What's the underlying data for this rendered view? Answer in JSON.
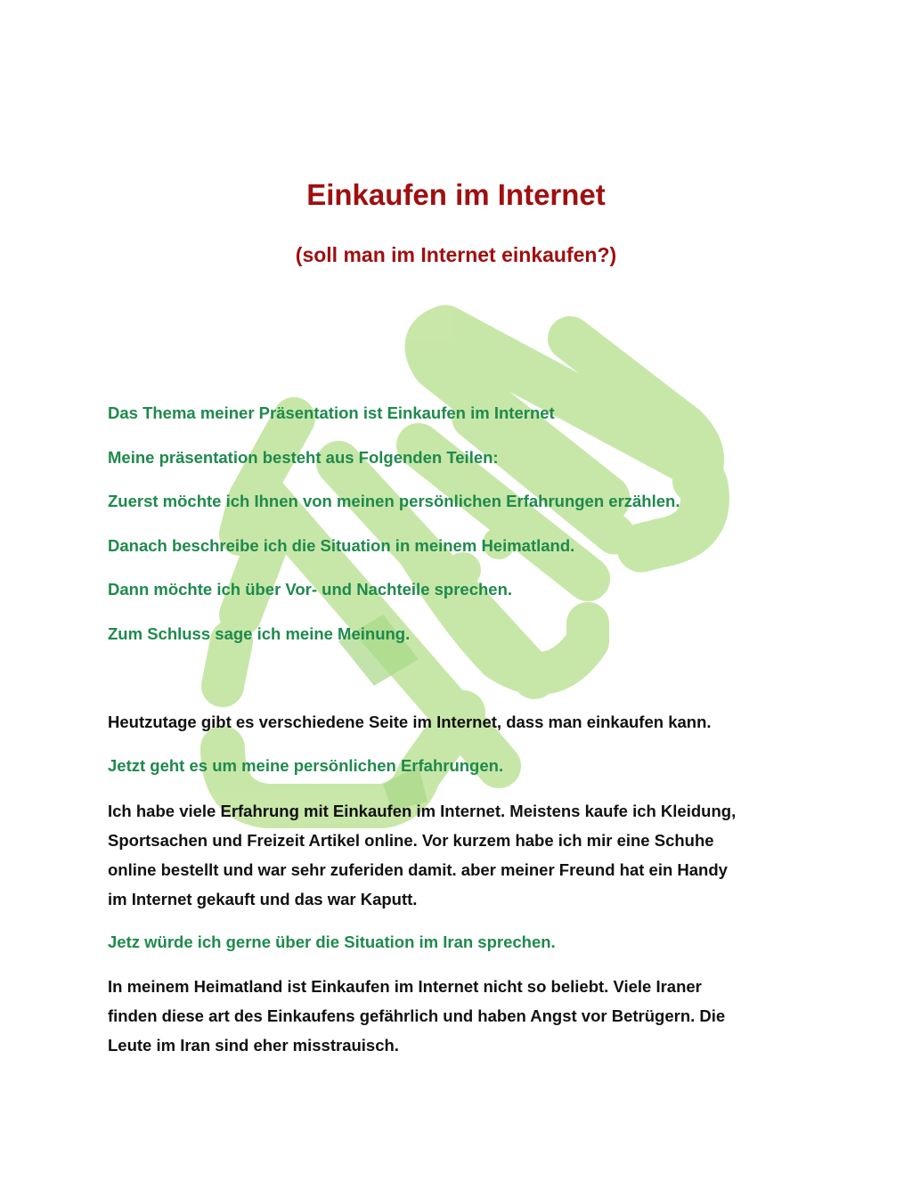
{
  "document": {
    "title": "Einkaufen im Internet",
    "subtitle": "(soll man im Internet einkaufen?)",
    "intro_lines": [
      "Das Thema meiner Präsentation ist Einkaufen im Internet",
      "Meine präsentation besteht aus Folgenden Teilen:",
      "Zuerst möchte ich Ihnen von meinen persönlichen Erfahrungen erzählen.",
      "Danach beschreibe ich die Situation in meinem Heimatland.",
      "Dann möchte ich über Vor-  und Nachteile sprechen.",
      "Zum Schluss sage ich meine Meinung."
    ],
    "statement": "Heutzutage gibt es verschiedene Seite im Internet, dass man einkaufen kann.",
    "transition_1": "Jetzt geht es um meine persönlichen Erfahrungen.",
    "paragraph_1": [
      "Ich habe viele Erfahrung mit Einkaufen im Internet. Meistens kaufe ich Kleidung,",
      "Sportsachen und Freizeit Artikel online. Vor kurzem habe ich mir eine Schuhe",
      "online bestellt und war sehr zuferiden damit. aber meiner Freund hat ein Handy",
      "im Internet gekauft und das war Kaputt."
    ],
    "transition_2": "Jetz würde ich gerne über die Situation im Iran sprechen.",
    "paragraph_2": [
      "In meinem Heimatland ist Einkaufen im Internet nicht so beliebt. Viele Iraner",
      "finden diese art des Einkaufens gefährlich und haben Angst vor Betrügern. Die",
      "Leute im Iran sind eher misstrauisch."
    ]
  },
  "colors": {
    "title": "#a00f0f",
    "green_text": "#1e8a4c",
    "body_text": "#111111",
    "watermark": "#c5e6a4"
  },
  "watermark": {
    "icon": "green-hand-logo-icon"
  }
}
